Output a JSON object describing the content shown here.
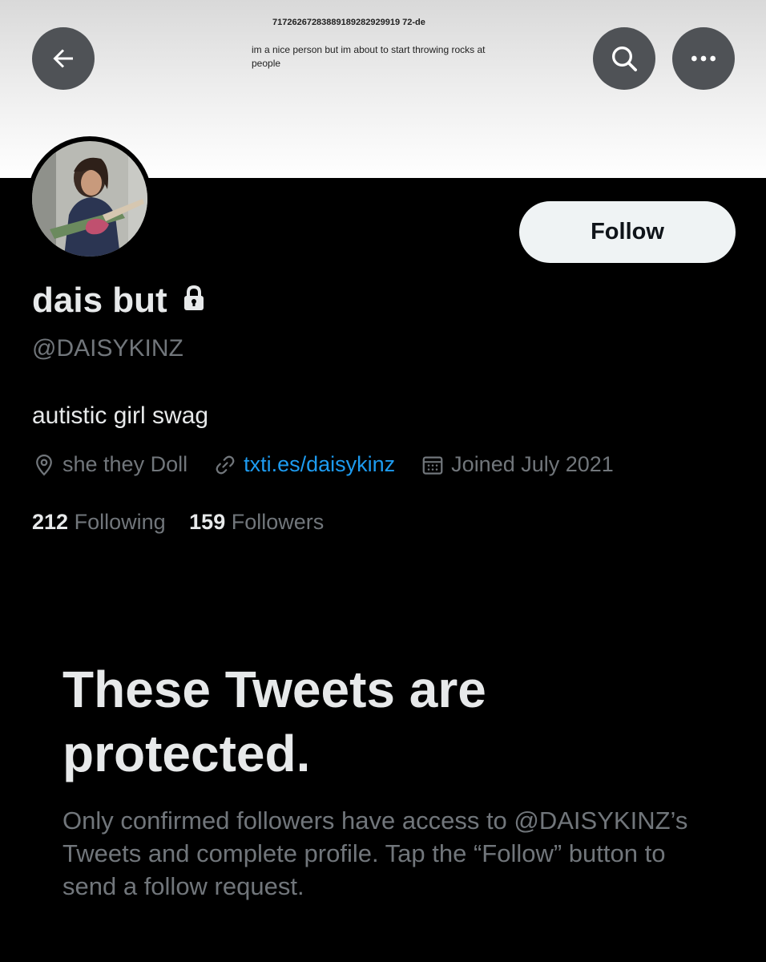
{
  "banner": {
    "id_text": "71726267283889189282929919 72-de",
    "text": "im  a nice person but im about to start throwing rocks at people"
  },
  "header": {
    "back_icon": "arrow-left-icon",
    "search_icon": "search-icon",
    "more_icon": "more-horizontal-icon"
  },
  "profile": {
    "display_name": "dais but",
    "protected_icon": "lock-icon",
    "handle": "@DAISYKINZ",
    "bio": "autistic girl swag",
    "follow_label": "Follow",
    "location": "she they Doll",
    "website": "txti.es/daisykinz",
    "joined": "Joined July 2021",
    "following_count": "212",
    "following_label": "Following",
    "followers_count": "159",
    "followers_label": "Followers"
  },
  "protected": {
    "title": "These Tweets are protected.",
    "description": "Only confirmed followers have access to @DAISYKINZ’s Tweets and complete profile. Tap the “Follow” button to send a follow request."
  },
  "colors": {
    "background": "#000000",
    "text_primary": "#e7e9ea",
    "text_secondary": "#71767b",
    "link": "#1d9bf0",
    "follow_button_bg": "#eff3f4"
  }
}
